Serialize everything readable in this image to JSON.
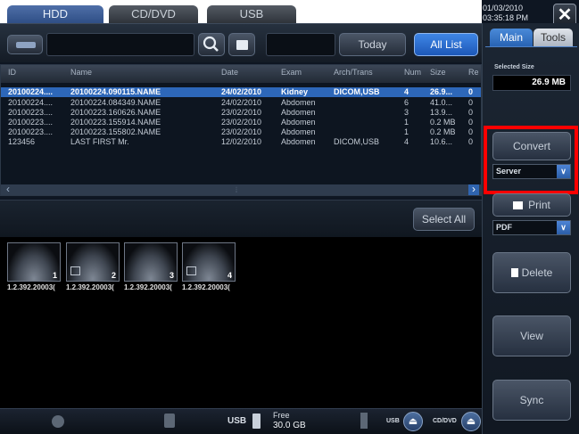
{
  "tabs": [
    {
      "label": "HDD"
    },
    {
      "label": "CD/DVD"
    },
    {
      "label": "USB"
    }
  ],
  "clock": {
    "date": "01/03/2010",
    "time": "03:35:18 PM"
  },
  "close_glyph": "✕",
  "toolbar": {
    "search_icon": "search-icon",
    "today_label": "Today",
    "all_list_label": "All List"
  },
  "table": {
    "headers": [
      "ID",
      "Name",
      "Date",
      "Exam",
      "Arch/Trans",
      "Num",
      "Size",
      "Re"
    ],
    "rows": [
      {
        "id": "20100224....",
        "name": "20100224.090115.NAME",
        "date": "24/02/2010",
        "exam": "Kidney",
        "arch": "DICOM,USB",
        "num": "4",
        "size": "26.9...",
        "re": "0",
        "selected": true
      },
      {
        "id": "20100224....",
        "name": "20100224.084349.NAME",
        "date": "24/02/2010",
        "exam": "Abdomen",
        "arch": "",
        "num": "6",
        "size": "41.0...",
        "re": "0",
        "selected": false
      },
      {
        "id": "20100223....",
        "name": "20100223.160626.NAME",
        "date": "23/02/2010",
        "exam": "Abdomen",
        "arch": "",
        "num": "3",
        "size": "13.9...",
        "re": "0",
        "selected": false
      },
      {
        "id": "20100223....",
        "name": "20100223.155914.NAME",
        "date": "23/02/2010",
        "exam": "Abdomen",
        "arch": "",
        "num": "1",
        "size": "0.2 MB",
        "re": "0",
        "selected": false
      },
      {
        "id": "20100223....",
        "name": "20100223.155802.NAME",
        "date": "23/02/2010",
        "exam": "Abdomen",
        "arch": "",
        "num": "1",
        "size": "0.2 MB",
        "re": "0",
        "selected": false
      },
      {
        "id": "123456",
        "name": "LAST FIRST  Mr.",
        "date": "12/02/2010",
        "exam": "Abdomen",
        "arch": "DICOM,USB",
        "num": "4",
        "size": "10.6...",
        "re": "0",
        "selected": false
      }
    ],
    "scroll_left": "‹",
    "scroll_right": "›",
    "scroll_grip": "⦙"
  },
  "select_all_label": "Select All",
  "thumbnails": [
    {
      "num": "1",
      "label": "1.2.392.20003("
    },
    {
      "num": "2",
      "label": "1.2.392.20003("
    },
    {
      "num": "3",
      "label": "1.2.392.20003("
    },
    {
      "num": "4",
      "label": "1.2.392.20003("
    }
  ],
  "status": {
    "usb_label": "USB",
    "free_label": "Free",
    "free_value": "30.0 GB",
    "usb_small": "USB",
    "cddvd_small": "CD/DVD",
    "eject_glyph": "⏏"
  },
  "right_panel": {
    "tab_main": "Main",
    "tab_tools": "Tools",
    "selected_size_label": "Selected Size",
    "selected_size_value": "26.9 MB",
    "convert_label": "Convert",
    "convert_target": "Server",
    "print_label": "Print",
    "print_target": "PDF",
    "delete_label": "Delete",
    "view_label": "View",
    "sync_label": "Sync",
    "dropdown_glyph": "∨"
  },
  "colors": {
    "highlight_box": "#ff0000",
    "selected_row": "#2d67b9",
    "accent_blue": "#3f86e6"
  }
}
